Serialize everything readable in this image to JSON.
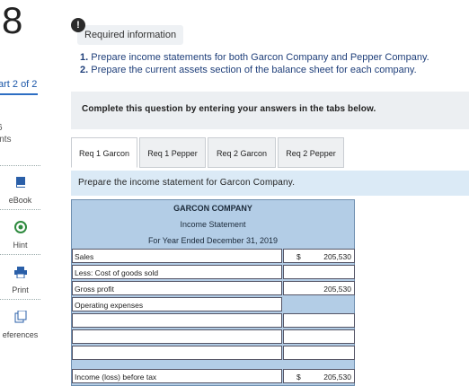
{
  "question": {
    "number": "8",
    "part": "art 2 of 2",
    "points_value": "6",
    "points_label": "ints"
  },
  "tools": {
    "ebook": "eBook",
    "hint": "Hint",
    "print": "Print",
    "references": "eferences"
  },
  "required_info": {
    "alert": "!",
    "label": "Required information"
  },
  "instructions": [
    {
      "num": "1.",
      "text": "Prepare income statements for both Garcon Company and Pepper Company."
    },
    {
      "num": "2.",
      "text": "Prepare the current assets section of the balance sheet for each company."
    }
  ],
  "complete_text": "Complete this question by entering your answers in the tabs below.",
  "tabs": [
    {
      "label": "Req 1 Garcon",
      "active": true
    },
    {
      "label": "Req 1 Pepper",
      "active": false
    },
    {
      "label": "Req 2 Garcon",
      "active": false
    },
    {
      "label": "Req 2 Pepper",
      "active": false
    }
  ],
  "prepare_text": "Prepare the income statement for Garcon Company.",
  "statement": {
    "company": "GARCON COMPANY",
    "title": "Income Statement",
    "period": "For Year Ended December 31, 2019",
    "rows": [
      {
        "label": "Sales",
        "currency": "$",
        "value": "205,530"
      },
      {
        "label": "Less: Cost of goods sold",
        "currency": "",
        "value": ""
      },
      {
        "label": "Gross profit",
        "currency": "",
        "value": "205,530"
      },
      {
        "label": "Operating expenses",
        "currency": "",
        "value": ""
      },
      {
        "label": "",
        "currency": "",
        "value": ""
      },
      {
        "label": "",
        "currency": "",
        "value": ""
      },
      {
        "label": "",
        "currency": "",
        "value": ""
      },
      {
        "label": "Income (loss) before tax",
        "currency": "$",
        "value": "205,530"
      }
    ]
  }
}
